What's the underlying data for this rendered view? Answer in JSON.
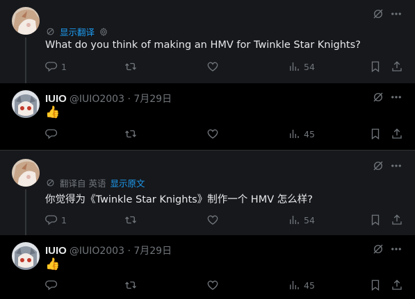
{
  "tweets": [
    {
      "translate_label": "显示翻译",
      "text": "What do you think of making an HMV for Twinkle Star Knights?",
      "stats": {
        "replies": "1",
        "views": "54"
      }
    },
    {
      "name": "IUIO",
      "handle": "@IUIO2003 · 7月29日",
      "text": "👍",
      "stats": {
        "views": "45"
      }
    },
    {
      "translated_from": "翻译自 英语",
      "show_original": "显示原文",
      "text": "你觉得为《Twinkle Star Knights》制作一个 HMV 怎么样?",
      "stats": {
        "replies": "1",
        "views": "54"
      }
    },
    {
      "name": "IUIO",
      "handle": "@IUIO2003 · 7月29日",
      "text": "👍",
      "stats": {
        "views": "45"
      }
    }
  ],
  "colors": {
    "accent": "#1d9bf0",
    "muted": "#71767b",
    "text": "#e7e9ea",
    "highlight_bg": "#16181c",
    "bg": "#000000"
  },
  "icons": [
    "grok-icon",
    "more-icon",
    "translate-icon",
    "settings-icon",
    "reply-icon",
    "retweet-icon",
    "like-icon",
    "views-icon",
    "bookmark-icon",
    "share-icon"
  ]
}
